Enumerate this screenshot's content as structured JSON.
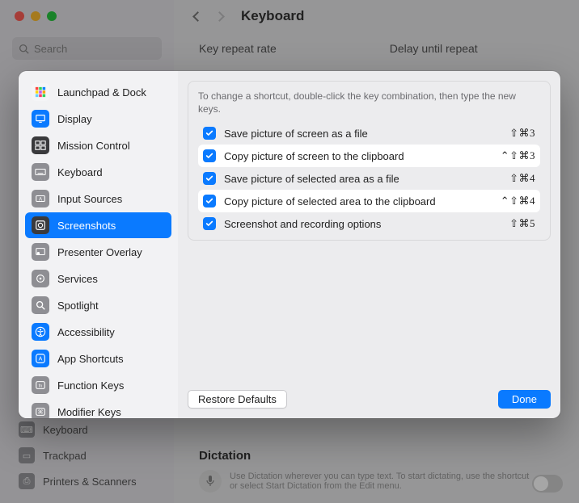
{
  "window": {
    "title": "Keyboard",
    "search_placeholder": "Search",
    "tabs": {
      "left": "Key repeat rate",
      "right": "Delay until repeat"
    }
  },
  "bg_sidebar": {
    "items": [
      {
        "icon": "⌨",
        "label": "Keyboard"
      },
      {
        "icon": "▭",
        "label": "Trackpad"
      },
      {
        "icon": "⎙",
        "label": "Printers & Scanners"
      }
    ]
  },
  "sidebar": {
    "items": [
      {
        "label": "Launchpad & Dock",
        "color": "#f5f5f7",
        "icon": "grid"
      },
      {
        "label": "Display",
        "color": "#0a7aff",
        "icon": "display"
      },
      {
        "label": "Mission Control",
        "color": "#3a3a3c",
        "icon": "mission"
      },
      {
        "label": "Keyboard",
        "color": "#8e8e93",
        "icon": "keyboard"
      },
      {
        "label": "Input Sources",
        "color": "#8e8e93",
        "icon": "input"
      },
      {
        "label": "Screenshots",
        "color": "#3a3a3c",
        "icon": "screenshot",
        "selected": true
      },
      {
        "label": "Presenter Overlay",
        "color": "#8e8e93",
        "icon": "presenter"
      },
      {
        "label": "Services",
        "color": "#8e8e93",
        "icon": "services"
      },
      {
        "label": "Spotlight",
        "color": "#8e8e93",
        "icon": "spotlight"
      },
      {
        "label": "Accessibility",
        "color": "#0a7aff",
        "icon": "accessibility"
      },
      {
        "label": "App Shortcuts",
        "color": "#0a7aff",
        "icon": "appshort"
      },
      {
        "label": "Function Keys",
        "color": "#8e8e93",
        "icon": "fn"
      },
      {
        "label": "Modifier Keys",
        "color": "#8e8e93",
        "icon": "modifier"
      }
    ]
  },
  "panel": {
    "instruction": "To change a shortcut, double-click the key combination, then type the new keys.",
    "shortcuts": [
      {
        "checked": true,
        "label": "Save picture of screen as a file",
        "keys": "⇧⌘3",
        "highlight": false
      },
      {
        "checked": true,
        "label": "Copy picture of screen to the clipboard",
        "keys": "⌃⇧⌘3",
        "highlight": true
      },
      {
        "checked": true,
        "label": "Save picture of selected area as a file",
        "keys": "⇧⌘4",
        "highlight": false
      },
      {
        "checked": true,
        "label": "Copy picture of selected area to the clipboard",
        "keys": "⌃⇧⌘4",
        "highlight": true
      },
      {
        "checked": true,
        "label": "Screenshot and recording options",
        "keys": "⇧⌘5",
        "highlight": false
      }
    ],
    "restore": "Restore Defaults",
    "done": "Done"
  },
  "dictation": {
    "heading": "Dictation",
    "text": "Use Dictation wherever you can type text. To start dictating, use the shortcut or select Start Dictation from the Edit menu."
  }
}
